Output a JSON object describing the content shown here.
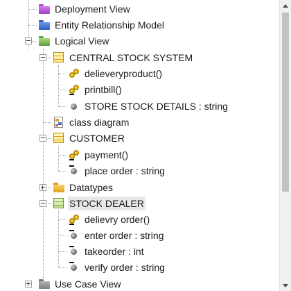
{
  "tree": {
    "deployment_view": {
      "label": "Deployment View",
      "icon": "purple-folder-icon"
    },
    "entity_relationship_model": {
      "label": "Entity Relationship Model",
      "icon": "blue-folder-icon"
    },
    "logical_view": {
      "label": "Logical View",
      "icon": "green-folder-icon",
      "expanded": true
    },
    "central_stock_system": {
      "label": "CENTRAL STOCK SYSTEM",
      "icon": "class-icon",
      "expanded": true,
      "members": [
        {
          "label": "delieveryproduct()",
          "icon": "method-icon"
        },
        {
          "label": "printbill()",
          "icon": "method-icon"
        },
        {
          "label": "STORE STOCK DETAILS : string",
          "icon": "attribute-icon"
        }
      ]
    },
    "class_diagram": {
      "label": "class diagram",
      "icon": "class-diagram-icon"
    },
    "customer": {
      "label": "CUSTOMER",
      "icon": "class-icon",
      "expanded": true,
      "members": [
        {
          "label": "payment()",
          "icon": "method-icon"
        },
        {
          "label": "place order : string",
          "icon": "attribute-icon"
        }
      ]
    },
    "datatypes": {
      "label": "Datatypes",
      "icon": "yellow-folder-icon",
      "expanded": false
    },
    "stock_dealer": {
      "label": "STOCK DEALER",
      "icon": "class-icon",
      "expanded": true,
      "selected": true,
      "members": [
        {
          "label": "delievry order()",
          "icon": "method-icon"
        },
        {
          "label": "enter order : string",
          "icon": "attribute-icon"
        },
        {
          "label": "takeorder : int",
          "icon": "attribute-icon"
        },
        {
          "label": "verify order : string",
          "icon": "attribute-icon"
        }
      ]
    },
    "use_case_view": {
      "label": "Use Case View",
      "icon": "gray-folder-icon",
      "expanded": false
    }
  },
  "colors": {
    "selection": "#e8e8e8",
    "connector": "#a0a0a0"
  }
}
